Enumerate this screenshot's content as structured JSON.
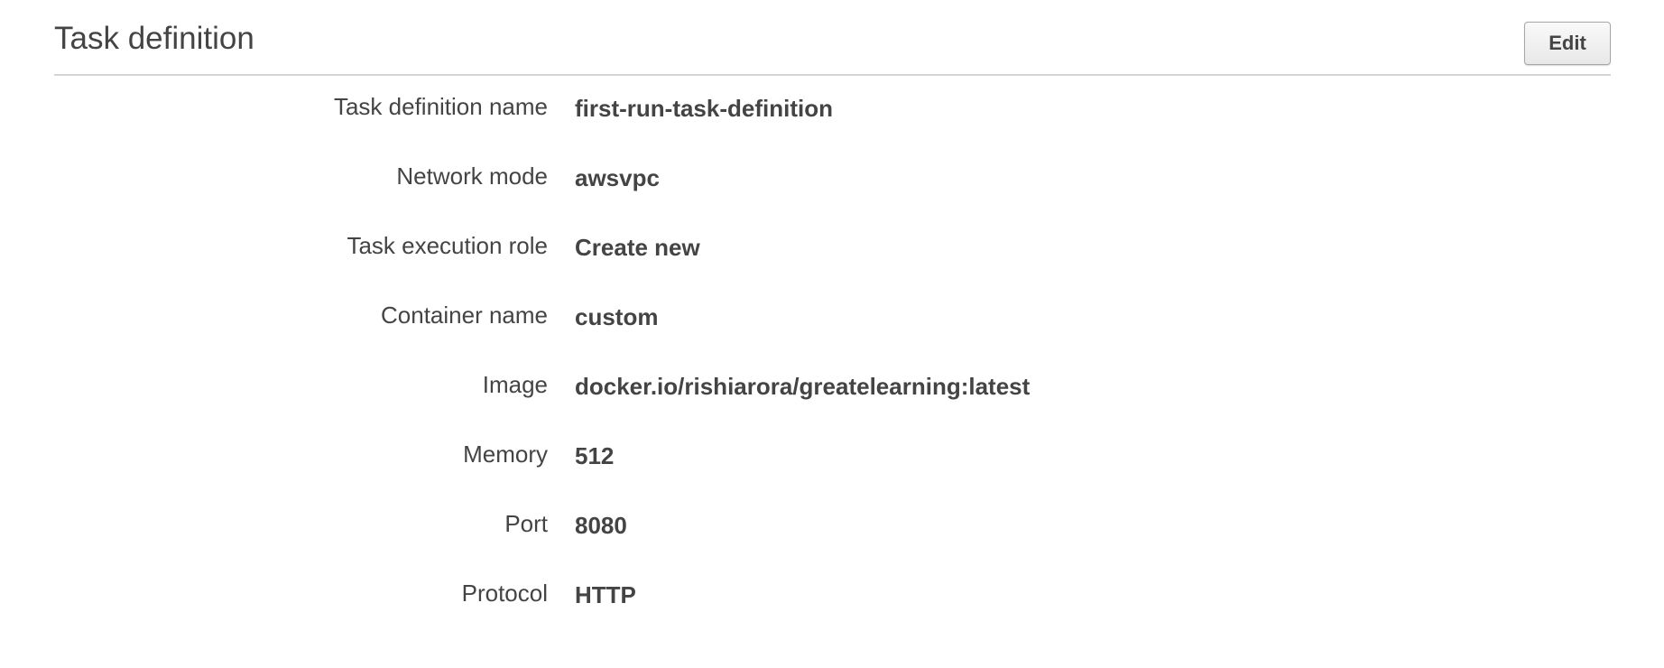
{
  "section": {
    "title": "Task definition",
    "edit_label": "Edit"
  },
  "fields": [
    {
      "label": "Task definition name",
      "value": "first-run-task-definition"
    },
    {
      "label": "Network mode",
      "value": "awsvpc"
    },
    {
      "label": "Task execution role",
      "value": "Create new"
    },
    {
      "label": "Container name",
      "value": "custom"
    },
    {
      "label": "Image",
      "value": "docker.io/rishiarora/greatelearning:latest"
    },
    {
      "label": "Memory",
      "value": "512"
    },
    {
      "label": "Port",
      "value": "8080"
    },
    {
      "label": "Protocol",
      "value": "HTTP"
    }
  ]
}
